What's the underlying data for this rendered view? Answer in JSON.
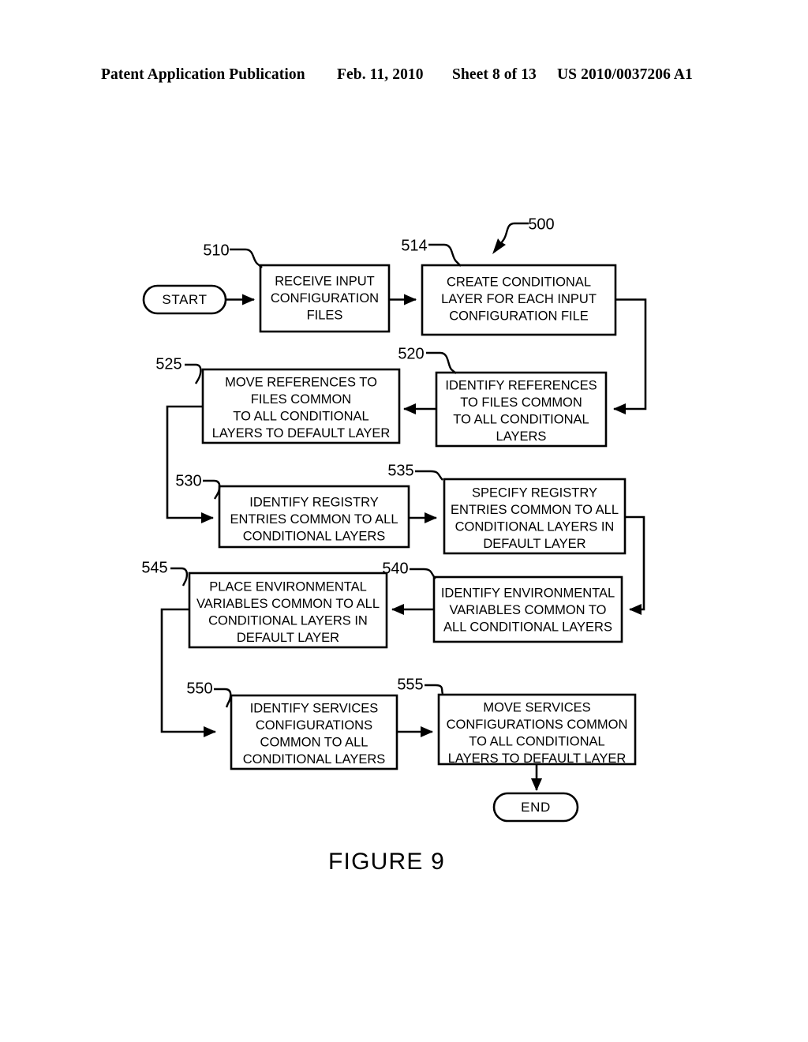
{
  "header": {
    "publication": "Patent Application Publication",
    "date": "Feb. 11, 2010",
    "sheet": "Sheet 8 of 13",
    "patent_number": "US 2010/0037206 A1"
  },
  "figure": {
    "caption": "FIGURE 9",
    "diagram_ref": "500",
    "start_label": "START",
    "end_label": "END"
  },
  "nodes": [
    {
      "ref": "510",
      "lines": [
        "RECEIVE INPUT",
        "CONFIGURATION",
        "FILES"
      ]
    },
    {
      "ref": "514",
      "lines": [
        "CREATE CONDITIONAL",
        "LAYER FOR EACH INPUT",
        "CONFIGURATION FILE"
      ]
    },
    {
      "ref": "520",
      "lines": [
        "IDENTIFY REFERENCES",
        "TO FILES COMMON",
        "TO ALL CONDITIONAL",
        "LAYERS"
      ]
    },
    {
      "ref": "525",
      "lines": [
        "MOVE REFERENCES TO",
        "FILES COMMON",
        "TO ALL CONDITIONAL",
        "LAYERS TO DEFAULT LAYER"
      ]
    },
    {
      "ref": "530",
      "lines": [
        "IDENTIFY REGISTRY",
        "ENTRIES COMMON TO ALL",
        "CONDITIONAL LAYERS"
      ]
    },
    {
      "ref": "535",
      "lines": [
        "SPECIFY REGISTRY",
        "ENTRIES COMMON TO ALL",
        "CONDITIONAL LAYERS IN",
        "DEFAULT LAYER"
      ]
    },
    {
      "ref": "540",
      "lines": [
        "IDENTIFY ENVIRONMENTAL",
        "VARIABLES COMMON TO",
        "ALL CONDITIONAL LAYERS"
      ]
    },
    {
      "ref": "545",
      "lines": [
        "PLACE ENVIRONMENTAL",
        "VARIABLES COMMON TO ALL",
        "CONDITIONAL LAYERS IN",
        "DEFAULT LAYER"
      ]
    },
    {
      "ref": "550",
      "lines": [
        "IDENTIFY SERVICES",
        "CONFIGURATIONS",
        "COMMON TO ALL",
        "CONDITIONAL LAYERS"
      ]
    },
    {
      "ref": "555",
      "lines": [
        "MOVE SERVICES",
        "CONFIGURATIONS COMMON",
        "TO ALL CONDITIONAL",
        "LAYERS TO DEFAULT LAYER"
      ]
    }
  ],
  "colors": {
    "ink": "#000000",
    "paper": "#ffffff"
  }
}
